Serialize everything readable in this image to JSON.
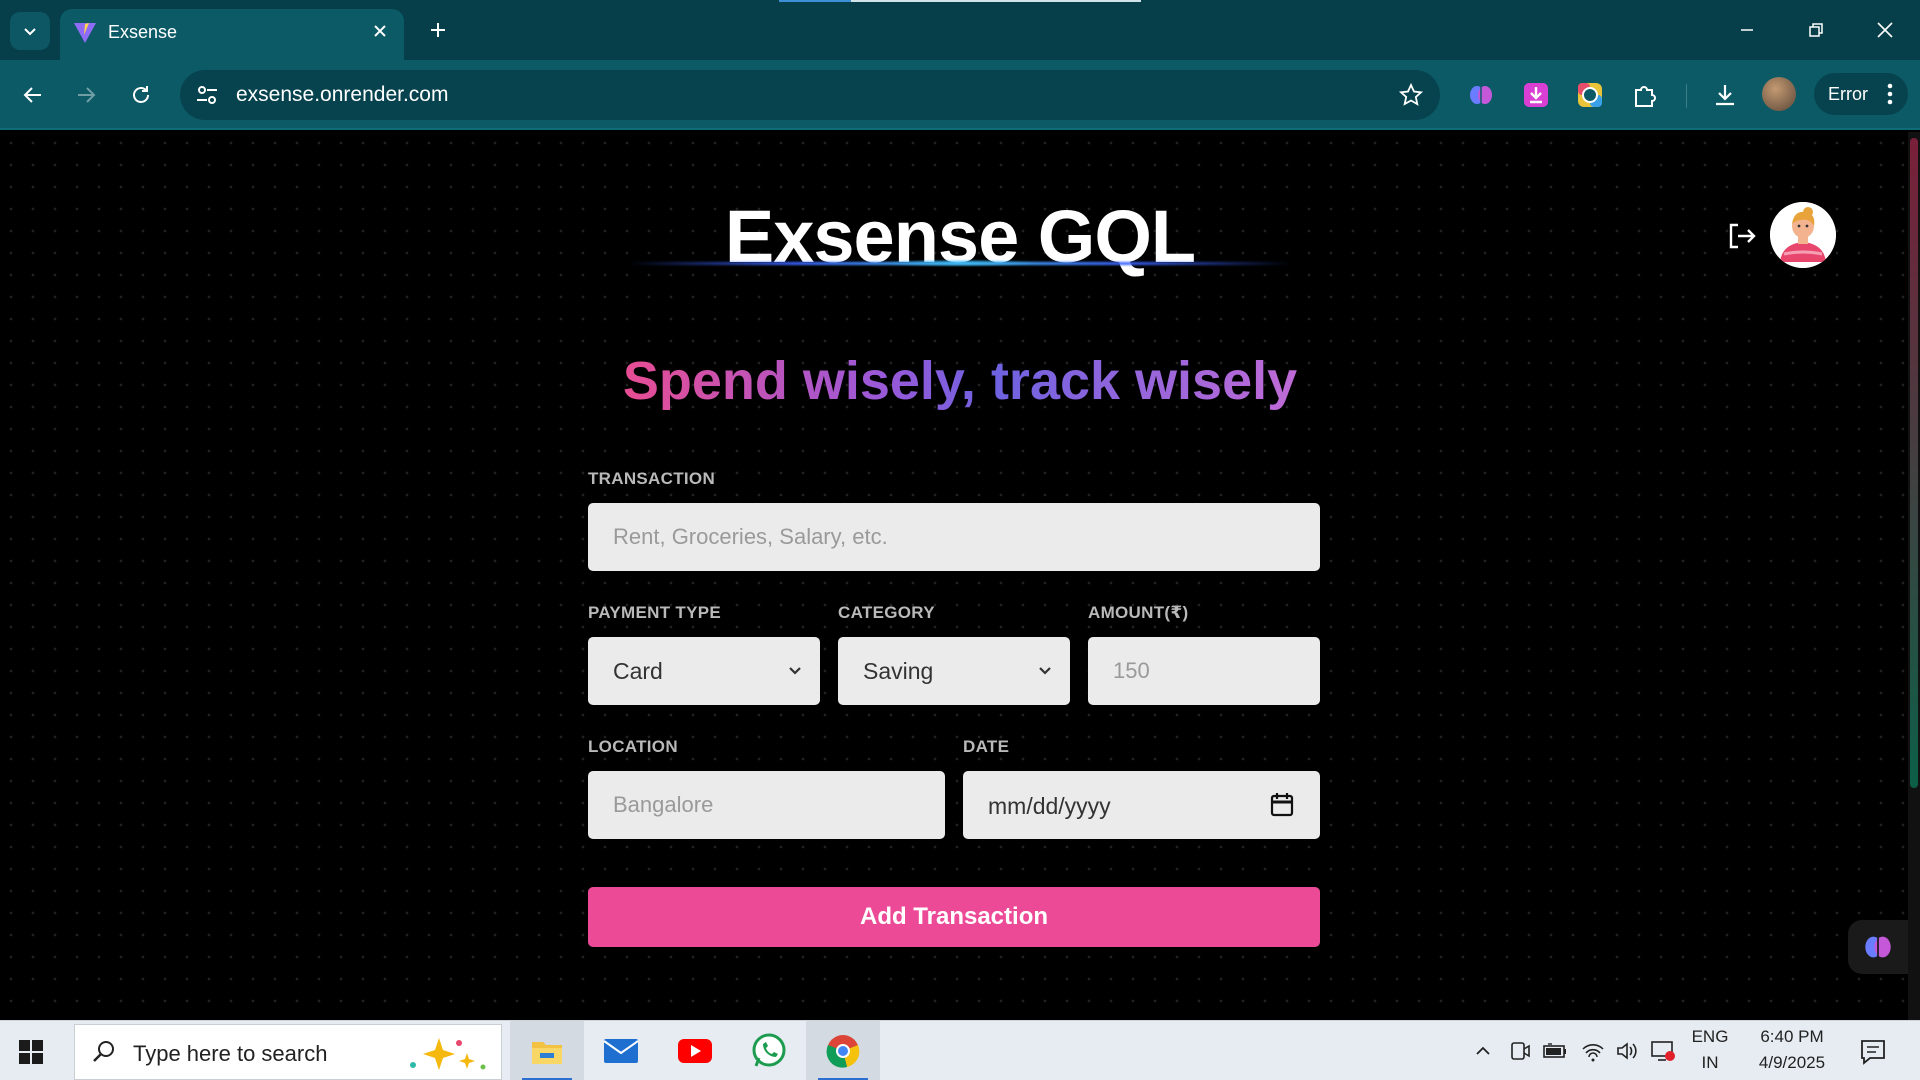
{
  "browser": {
    "tab_title": "Exsense",
    "url": "exsense.onrender.com",
    "error_label": "Error"
  },
  "page": {
    "app_title": "Exsense GQL",
    "tagline": "Spend wisely, track wisely",
    "form": {
      "transaction_label": "TRANSACTION",
      "transaction_placeholder": "Rent, Groceries, Salary, etc.",
      "payment_type_label": "PAYMENT TYPE",
      "payment_type_value": "Card",
      "category_label": "CATEGORY",
      "category_value": "Saving",
      "amount_label": "AMOUNT(₹)",
      "amount_placeholder": "150",
      "location_label": "LOCATION",
      "location_placeholder": "Bangalore",
      "date_label": "DATE",
      "date_value": "mm/dd/yyyy",
      "submit_label": "Add Transaction"
    }
  },
  "taskbar": {
    "search_placeholder": "Type here to search",
    "lang_primary": "ENG",
    "lang_secondary": "IN",
    "time": "6:40 PM",
    "date": "4/9/2025"
  },
  "colors": {
    "tabbar": "#063f4a",
    "toolbar": "#0b5a66",
    "accent_pink": "#ec4a96",
    "field_bg": "#ebebeb"
  }
}
